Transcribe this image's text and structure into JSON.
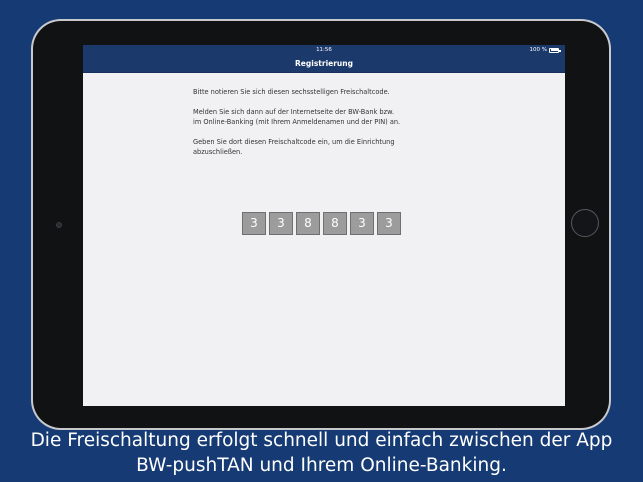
{
  "status_bar": {
    "time": "11:56",
    "battery_percent": "100 %",
    "battery_level": 1.0
  },
  "nav": {
    "title": "Registrierung"
  },
  "instructions": {
    "paragraph_1": "Bitte notieren Sie sich diesen sechsstelligen Freischaltcode.",
    "paragraph_2_line_1": "Melden Sie sich dann auf der Internetseite der BW-Bank bzw.",
    "paragraph_2_line_2": "im Online-Banking (mit Ihrem Anmeldenamen und der PIN) an.",
    "paragraph_3_line_1": "Geben Sie dort diesen Freischaltcode ein, um die Einrichtung",
    "paragraph_3_line_2": "abzuschließen."
  },
  "activation_code": {
    "digits": [
      "3",
      "3",
      "8",
      "8",
      "3",
      "3"
    ]
  },
  "caption": {
    "line_1": "Die Freischaltung erfolgt schnell und einfach zwischen der App",
    "line_2": "BW-pushTAN und Ihrem Online-Banking."
  },
  "colors": {
    "background": "#163a73",
    "nav_bar": "#1b3a6b",
    "screen": "#f1f1f4",
    "digit_box": "#9c9c9c"
  }
}
